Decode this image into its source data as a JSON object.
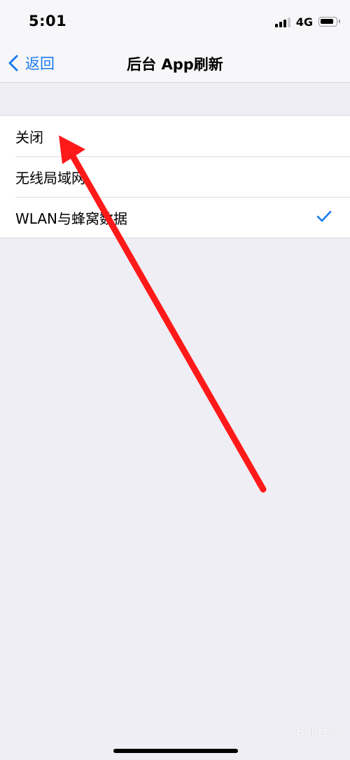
{
  "status_bar": {
    "time": "5:01",
    "network": "4G",
    "icons": [
      "signal-icon",
      "battery-icon"
    ]
  },
  "nav": {
    "back_label": "返回",
    "back_icon": "chevron-left-icon",
    "title": "后台 App刷新"
  },
  "options": [
    {
      "label": "关闭",
      "selected": false
    },
    {
      "label": "无线局域网",
      "selected": false
    },
    {
      "label": "WLAN与蜂窝数据",
      "selected": true
    }
  ],
  "selected_check_icon": "checkmark-icon",
  "annotation": {
    "icon": "red-arrow-icon",
    "color": "#ff1a1a"
  },
  "watermark": {
    "text": "Bai 经验"
  },
  "colors": {
    "accent": "#1b7cf0",
    "background": "#efeef4",
    "annotation": "#ff1a1a"
  }
}
